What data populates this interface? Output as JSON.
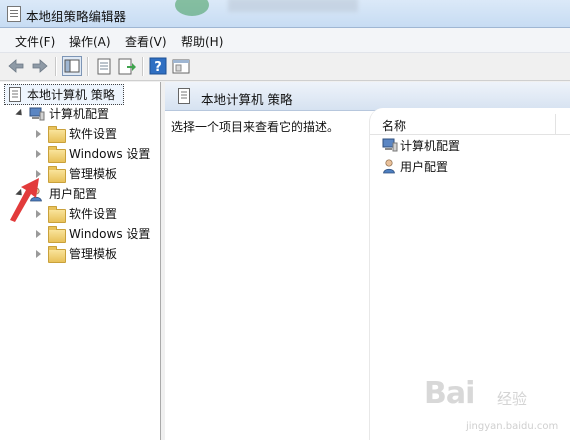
{
  "window": {
    "title": "本地组策略编辑器"
  },
  "menu": [
    {
      "label": "文件(F)"
    },
    {
      "label": "操作(A)"
    },
    {
      "label": "查看(V)"
    },
    {
      "label": "帮助(H)"
    }
  ],
  "toolbar": {
    "icons": [
      "back-arrow-icon",
      "forward-arrow-icon",
      "show-tree-icon",
      "properties-icon",
      "export-list-icon",
      "help-icon",
      "console-pane-icon"
    ]
  },
  "tree": {
    "root": "本地计算机 策略",
    "computer": {
      "label": "计算机配置",
      "children": [
        "软件设置",
        "Windows 设置",
        "管理模板"
      ]
    },
    "user": {
      "label": "用户配置",
      "children": [
        "软件设置",
        "Windows 设置",
        "管理模板"
      ]
    }
  },
  "detail": {
    "title": "本地计算机 策略",
    "description": "选择一个项目来查看它的描述。",
    "column_name": "名称",
    "items": [
      "计算机配置",
      "用户配置"
    ]
  },
  "watermark": {
    "logo": "Bai",
    "site": "jingyan.baidu.com",
    "text": "经验"
  },
  "colors": {
    "title_bar": "#c7dcf3",
    "accent_arrow": "#e23b3b",
    "folder": "#e8c15a"
  }
}
